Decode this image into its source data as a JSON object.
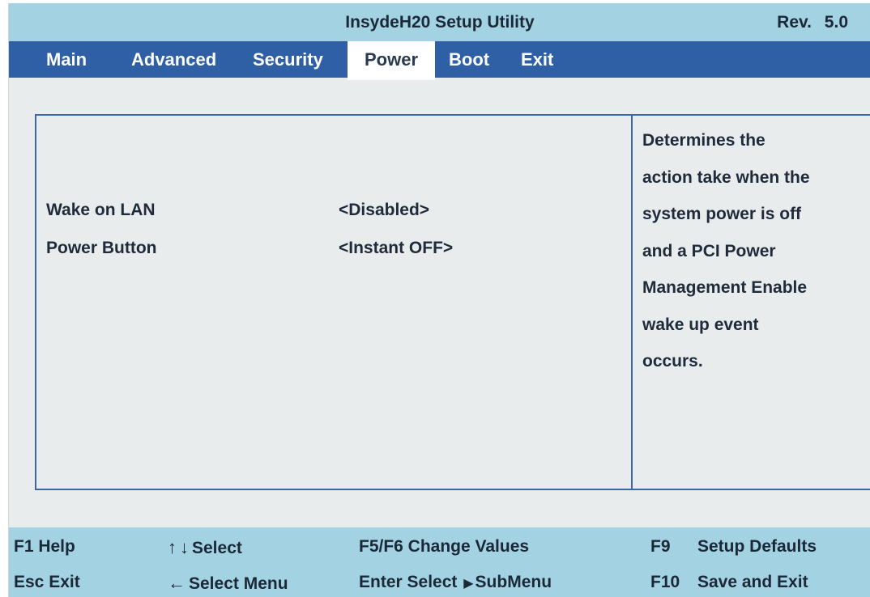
{
  "window": {
    "title": "InsydeH20 Setup Utility",
    "revision": "Rev. 5.0"
  },
  "tabs": [
    {
      "label": "Main"
    },
    {
      "label": "Advanced"
    },
    {
      "label": "Security"
    },
    {
      "label": "Power",
      "active": true
    },
    {
      "label": "Boot"
    },
    {
      "label": "Exit"
    }
  ],
  "settings": [
    {
      "label": "Wake on LAN",
      "value": "<Disabled>"
    },
    {
      "label": "Power Button",
      "value": "<Instant OFF>"
    }
  ],
  "help": {
    "lines": [
      "Determines the",
      "action take when the",
      "system power is off",
      "and a PCI Power",
      "Management Enable",
      "wake up event",
      "occurs."
    ]
  },
  "footer": {
    "f1": "F1 Help",
    "select_updown": "Select",
    "f5f6": "F5/F6 Change Values",
    "f9_key": "F9",
    "f9_label": "Setup Defaults",
    "esc": "Esc Exit",
    "select_menu": "Select Menu",
    "enter_select": "Enter Select",
    "submenu": "SubMenu",
    "f10_key": "F10",
    "f10_label": "Save and Exit"
  },
  "colors": {
    "title_bar": "#a3d3e2",
    "menu_bar": "#2f5fa5",
    "panel_border": "#3c66a8",
    "background": "#e9ecec"
  }
}
